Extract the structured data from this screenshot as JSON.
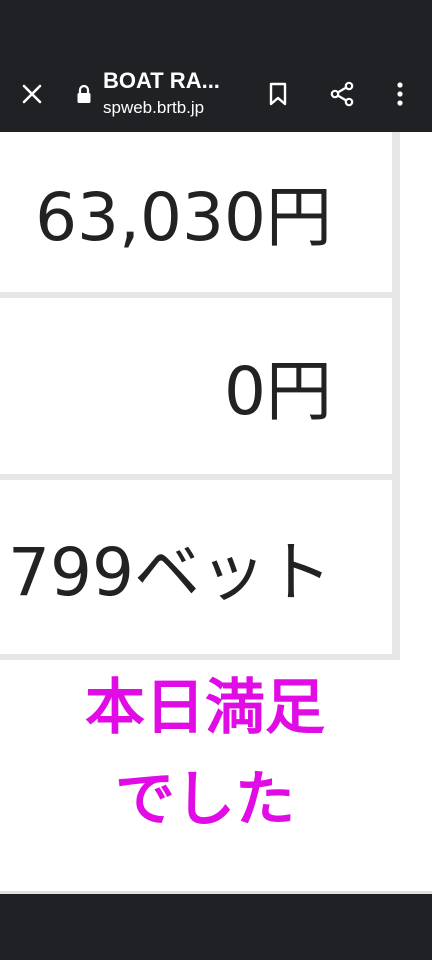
{
  "toolbar": {
    "title": "BOAT RA...",
    "url": "spweb.brtb.jp",
    "icons": {
      "close": "close-icon",
      "lock": "lock-icon",
      "bookmark": "bookmark-icon",
      "share": "share-icon",
      "menu": "more-vert-icon"
    }
  },
  "table": {
    "rows": [
      {
        "value": "63,030円"
      },
      {
        "value": "0円"
      },
      {
        "value": "799ベット"
      }
    ]
  },
  "message": {
    "line1": "本日満足",
    "line2": "でした",
    "color": "#e10be6"
  }
}
